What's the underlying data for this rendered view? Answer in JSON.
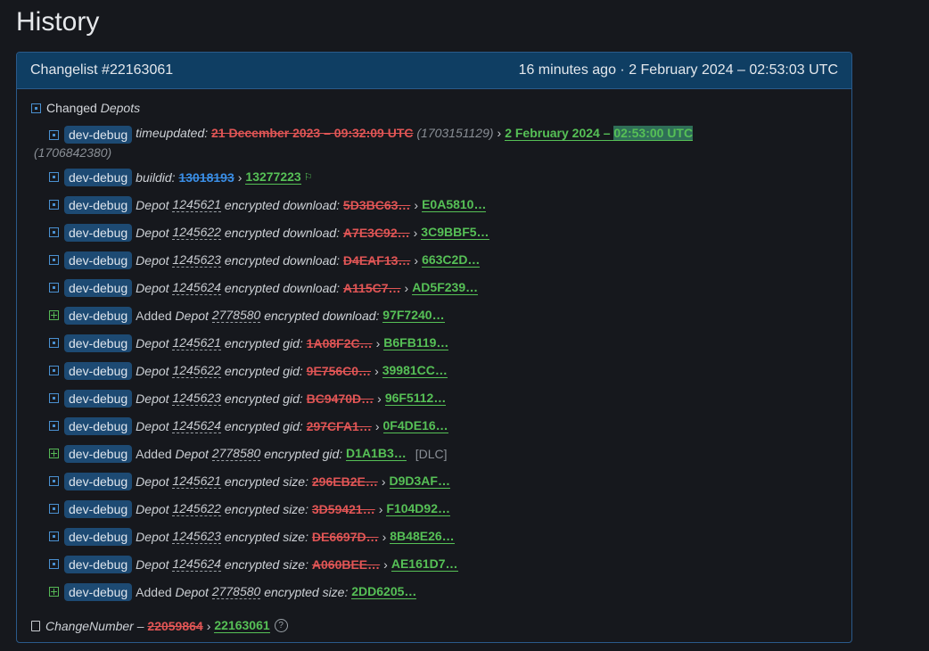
{
  "page": {
    "title": "History"
  },
  "changelist": {
    "title": "Changelist #22163061",
    "time": "16 minutes ago · 2 February 2024 – 02:53:03 UTC"
  },
  "section": {
    "label": "Changed",
    "label_italic": "Depots"
  },
  "tag": "dev-debug",
  "first_row": {
    "key": "timeupdated:",
    "old": "21 December 2023 – 09:32:09 UTC",
    "old_raw": "(1703151129)",
    "new_a": "2 February 2024 – ",
    "new_b": "02:53:00 UTC",
    "new_raw": "(1706842380)"
  },
  "build_row": {
    "key": "buildid:",
    "old": "13018193",
    "new": "13277223"
  },
  "rows": [
    {
      "type": "mod",
      "prefix": "Depot",
      "depot": "1245621",
      "field": "encrypted download:",
      "old": "5D3BC63…",
      "new": "E0A5810…"
    },
    {
      "type": "mod",
      "prefix": "Depot",
      "depot": "1245622",
      "field": "encrypted download:",
      "old": "A7E3C92…",
      "new": "3C9BBF5…"
    },
    {
      "type": "mod",
      "prefix": "Depot",
      "depot": "1245623",
      "field": "encrypted download:",
      "old": "D4EAF13…",
      "new": "663C2D…"
    },
    {
      "type": "mod",
      "prefix": "Depot",
      "depot": "1245624",
      "field": "encrypted download:",
      "old": "A115C7…",
      "new": "AD5F239…"
    },
    {
      "type": "add",
      "prefix": "Depot",
      "depot": "2778580",
      "field": "encrypted download:",
      "new": "97F7240…"
    },
    {
      "type": "mod",
      "prefix": "Depot",
      "depot": "1245621",
      "field": "encrypted gid:",
      "old": "1A08F2C…",
      "new": "B6FB119…"
    },
    {
      "type": "mod",
      "prefix": "Depot",
      "depot": "1245622",
      "field": "encrypted gid:",
      "old": "9E756C0…",
      "new": "39981CC…"
    },
    {
      "type": "mod",
      "prefix": "Depot",
      "depot": "1245623",
      "field": "encrypted gid:",
      "old": "BC9470D…",
      "new": "96F5112…"
    },
    {
      "type": "mod",
      "prefix": "Depot",
      "depot": "1245624",
      "field": "encrypted gid:",
      "old": "297CFA1…",
      "new": "0F4DE16…"
    },
    {
      "type": "add",
      "prefix": "Depot",
      "depot": "2778580",
      "field": "encrypted gid:",
      "new": "D1A1B3…",
      "extra": "[DLC]"
    },
    {
      "type": "mod",
      "prefix": "Depot",
      "depot": "1245621",
      "field": "encrypted size:",
      "old": "296EB2E…",
      "new": "D9D3AF…"
    },
    {
      "type": "mod",
      "prefix": "Depot",
      "depot": "1245622",
      "field": "encrypted size:",
      "old": "3D59421…",
      "new": "F104D92…"
    },
    {
      "type": "mod",
      "prefix": "Depot",
      "depot": "1245623",
      "field": "encrypted size:",
      "old": "DE6697D…",
      "new": "8B48E26…"
    },
    {
      "type": "mod",
      "prefix": "Depot",
      "depot": "1245624",
      "field": "encrypted size:",
      "old": "A060BEE…",
      "new": "AE161D7…"
    },
    {
      "type": "add",
      "prefix": "Depot",
      "depot": "2778580",
      "field": "encrypted size:",
      "new": "2DD6205…"
    }
  ],
  "added_label": "Added",
  "footer": {
    "key": "ChangeNumber –",
    "old": "22059864",
    "new": "22163061"
  },
  "colors": {
    "accent": "#0f3e63",
    "removed": "#e05555",
    "added": "#56c056",
    "tag": "#1d4a73"
  }
}
